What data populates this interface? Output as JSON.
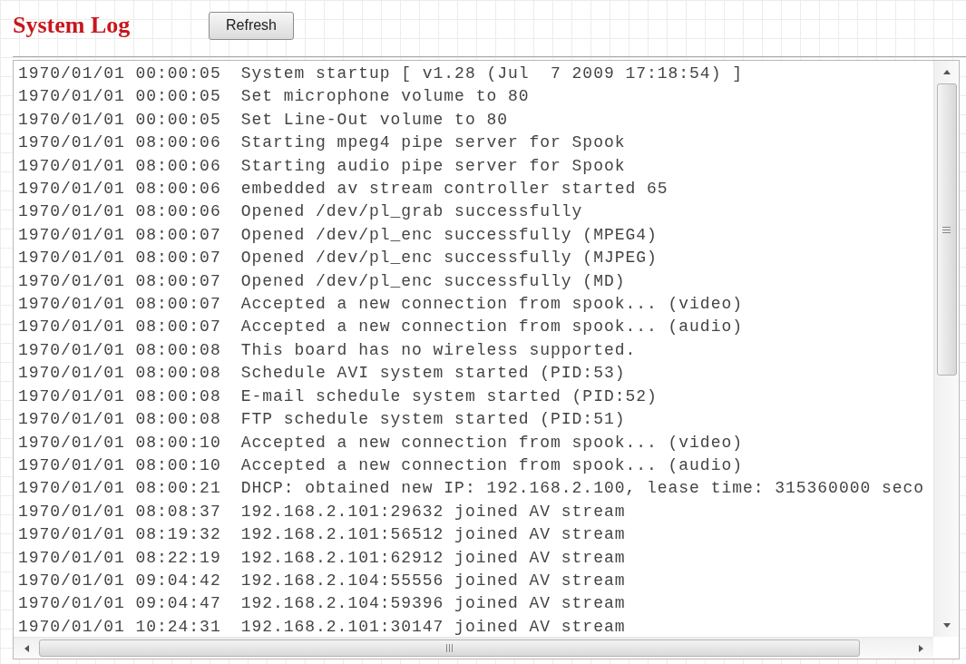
{
  "title": "System Log",
  "refresh_button": {
    "label": "Refresh"
  },
  "log": {
    "entries": [
      {
        "time": "1970/01/01 00:00:05",
        "message": "System startup [ v1.28 (Jul  7 2009 17:18:54) ]"
      },
      {
        "time": "1970/01/01 00:00:05",
        "message": "Set microphone volume to 80"
      },
      {
        "time": "1970/01/01 00:00:05",
        "message": "Set Line-Out volume to 80"
      },
      {
        "time": "1970/01/01 08:00:06",
        "message": "Starting mpeg4 pipe server for Spook"
      },
      {
        "time": "1970/01/01 08:00:06",
        "message": "Starting audio pipe server for Spook"
      },
      {
        "time": "1970/01/01 08:00:06",
        "message": "embedded av stream controller started 65"
      },
      {
        "time": "1970/01/01 08:00:06",
        "message": "Opened /dev/pl_grab successfully"
      },
      {
        "time": "1970/01/01 08:00:07",
        "message": "Opened /dev/pl_enc successfully (MPEG4)"
      },
      {
        "time": "1970/01/01 08:00:07",
        "message": "Opened /dev/pl_enc successfully (MJPEG)"
      },
      {
        "time": "1970/01/01 08:00:07",
        "message": "Opened /dev/pl_enc successfully (MD)"
      },
      {
        "time": "1970/01/01 08:00:07",
        "message": "Accepted a new connection from spook... (video)"
      },
      {
        "time": "1970/01/01 08:00:07",
        "message": "Accepted a new connection from spook... (audio)"
      },
      {
        "time": "1970/01/01 08:00:08",
        "message": "This board has no wireless supported."
      },
      {
        "time": "1970/01/01 08:00:08",
        "message": "Schedule AVI system started (PID:53)"
      },
      {
        "time": "1970/01/01 08:00:08",
        "message": "E-mail schedule system started (PID:52)"
      },
      {
        "time": "1970/01/01 08:00:08",
        "message": "FTP schedule system started (PID:51)"
      },
      {
        "time": "1970/01/01 08:00:10",
        "message": "Accepted a new connection from spook... (video)"
      },
      {
        "time": "1970/01/01 08:00:10",
        "message": "Accepted a new connection from spook... (audio)"
      },
      {
        "time": "1970/01/01 08:00:21",
        "message": "DHCP: obtained new IP: 192.168.2.100, lease time: 315360000 seco"
      },
      {
        "time": "1970/01/01 08:08:37",
        "message": "192.168.2.101:29632 joined AV stream"
      },
      {
        "time": "1970/01/01 08:19:32",
        "message": "192.168.2.101:56512 joined AV stream"
      },
      {
        "time": "1970/01/01 08:22:19",
        "message": "192.168.2.101:62912 joined AV stream"
      },
      {
        "time": "1970/01/01 09:04:42",
        "message": "192.168.2.104:55556 joined AV stream"
      },
      {
        "time": "1970/01/01 09:04:47",
        "message": "192.168.2.104:59396 joined AV stream"
      },
      {
        "time": "1970/01/01 10:24:31",
        "message": "192.168.2.101:30147 joined AV stream"
      }
    ]
  }
}
